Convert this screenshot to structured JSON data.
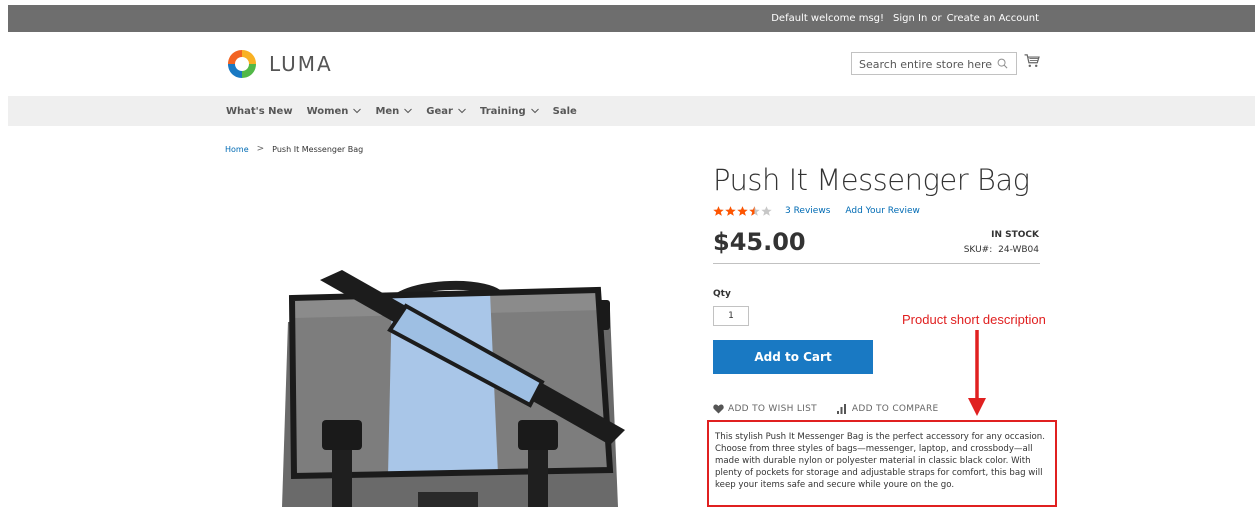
{
  "topbar": {
    "welcome": "Default welcome msg!",
    "sign_in": "Sign In",
    "or": "or",
    "create_account": "Create an Account"
  },
  "header": {
    "logo_text": "LUMA",
    "search_placeholder": "Search entire store here...",
    "cart_icon": "cart-icon"
  },
  "nav": {
    "items": [
      {
        "label": "What's New",
        "dropdown": false
      },
      {
        "label": "Women",
        "dropdown": true
      },
      {
        "label": "Men",
        "dropdown": true
      },
      {
        "label": "Gear",
        "dropdown": true
      },
      {
        "label": "Training",
        "dropdown": true
      },
      {
        "label": "Sale",
        "dropdown": false
      }
    ]
  },
  "breadcrumb": {
    "home": "Home",
    "separator": ">",
    "current": "Push It Messenger Bag"
  },
  "product": {
    "title": "Push It Messenger Bag",
    "rating_fraction": 0.7,
    "reviews_link": "3 Reviews",
    "add_review_link": "Add Your Review",
    "price": "$45.00",
    "stock": "IN STOCK",
    "sku_label": "SKU#:",
    "sku": "24-WB04",
    "qty_label": "Qty",
    "qty_value": "1",
    "add_to_cart": "Add to Cart",
    "wishlist": "ADD TO WISH LIST",
    "compare": "ADD TO COMPARE",
    "short_description": "This stylish Push It Messenger Bag is the perfect accessory for any occasion. Choose from three styles of bags—messenger, laptop, and crossbody—all made with durable nylon or polyester material in classic black color. With plenty of pockets for storage and adjustable straps for comfort, this bag will keep your items safe and secure while youre on the go."
  },
  "annotation": {
    "label": "Product short description"
  },
  "colors": {
    "link": "#006bb4",
    "button": "#1979c3",
    "star": "#ff5501",
    "annotation": "#e02020"
  }
}
